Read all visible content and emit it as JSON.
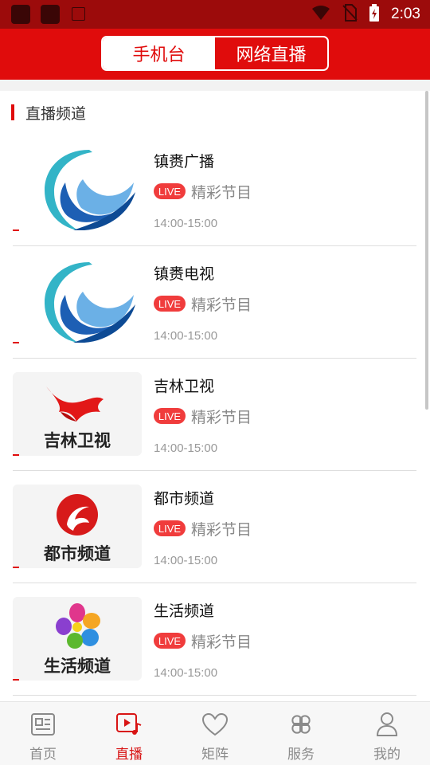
{
  "status_bar": {
    "time": "2:03"
  },
  "header": {
    "tabs": [
      {
        "label": "手机台",
        "active": true
      },
      {
        "label": "网络直播",
        "active": false
      }
    ]
  },
  "section": {
    "title": "直播频道"
  },
  "channels": [
    {
      "name": "镇赉广播",
      "badge": "LIVE",
      "program": "精彩节目",
      "time": "14:00-15:00",
      "logo": "zhenlai-logo"
    },
    {
      "name": "镇赉电视",
      "badge": "LIVE",
      "program": "精彩节目",
      "time": "14:00-15:00",
      "logo": "zhenlai-logo"
    },
    {
      "name": "吉林卫视",
      "badge": "LIVE",
      "program": "精彩节目",
      "time": "14:00-15:00",
      "logo": "jilin-tv-logo",
      "logo_caption": "吉林卫视"
    },
    {
      "name": "都市频道",
      "badge": "LIVE",
      "program": "精彩节目",
      "time": "14:00-15:00",
      "logo": "dushi-logo",
      "logo_caption": "都市频道"
    },
    {
      "name": "生活频道",
      "badge": "LIVE",
      "program": "精彩节目",
      "time": "14:00-15:00",
      "logo": "shenghuo-logo",
      "logo_caption": "生活频道"
    }
  ],
  "tabbar": [
    {
      "label": "首页",
      "icon": "news-icon",
      "active": false
    },
    {
      "label": "直播",
      "icon": "live-video-icon",
      "active": true
    },
    {
      "label": "矩阵",
      "icon": "heart-icon",
      "active": false
    },
    {
      "label": "服务",
      "icon": "grid-flower-icon",
      "active": false
    },
    {
      "label": "我的",
      "icon": "user-icon",
      "active": false
    }
  ],
  "colors": {
    "accent": "#e00c0c",
    "status_bar": "#9c0b0b",
    "live_badge": "#f03c3c",
    "tab_active": "#d81414"
  }
}
